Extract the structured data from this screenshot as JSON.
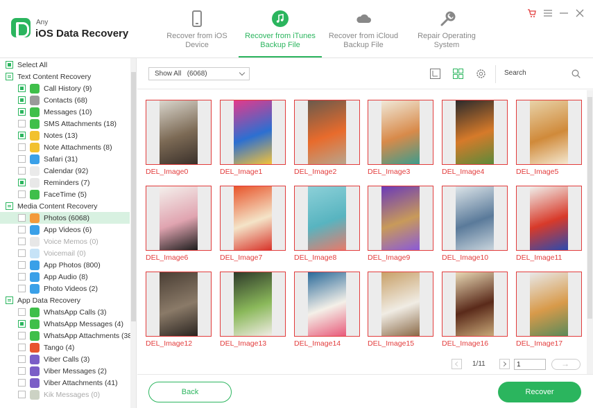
{
  "app": {
    "brand_prefix": "Any",
    "title": "iOS Data Recovery"
  },
  "nav_tabs": [
    {
      "label": "Recover from iOS\nDevice",
      "icon": "phone-icon",
      "active": false
    },
    {
      "label": "Recover from iTunes\nBackup File",
      "icon": "music-icon",
      "active": true
    },
    {
      "label": "Recover from iCloud\nBackup File",
      "icon": "cloud-icon",
      "active": false
    },
    {
      "label": "Repair Operating\nSystem",
      "icon": "wrench-icon",
      "active": false
    }
  ],
  "window_controls": [
    "cart-icon",
    "menu-icon",
    "minimize-icon",
    "close-icon"
  ],
  "sidebar": {
    "select_all": "Select All",
    "rows": [
      {
        "type": "category",
        "label": "Text Content Recovery"
      },
      {
        "type": "item",
        "label": "Call History (9)",
        "checked": true,
        "icon_color": "#3fbf4a",
        "icon": "phone-icon"
      },
      {
        "type": "item",
        "label": "Contacts (68)",
        "checked": true,
        "icon_color": "#9a9a9a",
        "icon": "contacts-icon"
      },
      {
        "type": "item",
        "label": "Messages (10)",
        "checked": true,
        "icon_color": "#3fbf4a",
        "icon": "message-icon"
      },
      {
        "type": "item",
        "label": "SMS Attachments (18)",
        "checked": false,
        "icon_color": "#3fbf4a",
        "icon": "attachment-icon"
      },
      {
        "type": "item",
        "label": "Notes (13)",
        "checked": true,
        "icon_color": "#f2c12e",
        "icon": "notes-icon"
      },
      {
        "type": "item",
        "label": "Note Attachments (8)",
        "checked": false,
        "icon_color": "#f2c12e",
        "icon": "note-attachment-icon"
      },
      {
        "type": "item",
        "label": "Safari (31)",
        "checked": false,
        "icon_color": "#3aa0e8",
        "icon": "safari-icon"
      },
      {
        "type": "item",
        "label": "Calendar (92)",
        "checked": false,
        "icon_color": "#eaeaea",
        "icon": "calendar-icon"
      },
      {
        "type": "item",
        "label": "Reminders (7)",
        "checked": true,
        "icon_color": "#e8e8e8",
        "icon": "reminders-icon"
      },
      {
        "type": "item",
        "label": "FaceTime (5)",
        "checked": false,
        "icon_color": "#3fbf4a",
        "icon": "facetime-icon"
      },
      {
        "type": "category",
        "label": "Media Content Recovery"
      },
      {
        "type": "item",
        "label": "Photos (6068)",
        "checked": false,
        "selected": true,
        "icon_color": "#f39a3c",
        "icon": "photos-icon"
      },
      {
        "type": "item",
        "label": "App Videos (6)",
        "checked": false,
        "icon_color": "#3aa0e8",
        "icon": "app-videos-icon"
      },
      {
        "type": "item",
        "label": "Voice Memos (0)",
        "checked": false,
        "disabled": true,
        "icon_color": "#cfcfcf",
        "icon": "voice-memos-icon"
      },
      {
        "type": "item",
        "label": "Voicemail (0)",
        "checked": false,
        "disabled": true,
        "icon_color": "#8ec7ef",
        "icon": "voicemail-icon"
      },
      {
        "type": "item",
        "label": "App Photos (800)",
        "checked": false,
        "icon_color": "#3aa0e8",
        "icon": "app-photos-icon"
      },
      {
        "type": "item",
        "label": "App Audio (8)",
        "checked": false,
        "icon_color": "#3aa0e8",
        "icon": "app-audio-icon"
      },
      {
        "type": "item",
        "label": "Photo Videos (2)",
        "checked": false,
        "icon_color": "#3aa0e8",
        "icon": "photo-videos-icon"
      },
      {
        "type": "category",
        "label": "App Data Recovery"
      },
      {
        "type": "item",
        "label": "WhatsApp Calls (3)",
        "checked": false,
        "icon_color": "#3fbf4a",
        "icon": "whatsapp-calls-icon"
      },
      {
        "type": "item",
        "label": "WhatsApp Messages (4)",
        "checked": true,
        "icon_color": "#3fbf4a",
        "icon": "whatsapp-icon"
      },
      {
        "type": "item",
        "label": "WhatsApp Attachments (38)",
        "checked": false,
        "icon_color": "#3fbf4a",
        "icon": "whatsapp-attachments-icon"
      },
      {
        "type": "item",
        "label": "Tango (4)",
        "checked": false,
        "icon_color": "#e8542e",
        "icon": "tango-icon"
      },
      {
        "type": "item",
        "label": "Viber Calls (3)",
        "checked": false,
        "icon_color": "#7b5ec7",
        "icon": "viber-icon"
      },
      {
        "type": "item",
        "label": "Viber Messages (2)",
        "checked": false,
        "icon_color": "#7b5ec7",
        "icon": "viber-messages-icon"
      },
      {
        "type": "item",
        "label": "Viber Attachments (41)",
        "checked": false,
        "icon_color": "#7b5ec7",
        "icon": "viber-attachments-icon"
      },
      {
        "type": "item",
        "label": "Kik Messages (0)",
        "checked": false,
        "disabled": true,
        "icon_color": "#9aa58a",
        "icon": "kik-icon"
      }
    ]
  },
  "toolbar": {
    "filter_value": "Show All   (6068)",
    "search_label": "Search",
    "tools": [
      "calendar-filter-icon",
      "grid-view-icon",
      "settings-icon"
    ]
  },
  "thumbnails": [
    {
      "label": "DEL_Image0",
      "colors": [
        "#d9d5cc",
        "#7c6a55",
        "#3a302a"
      ]
    },
    {
      "label": "DEL_Image1",
      "colors": [
        "#e33a8c",
        "#2c6fd1",
        "#f3c23a"
      ]
    },
    {
      "label": "DEL_Image2",
      "colors": [
        "#6a5a4c",
        "#e86b2c",
        "#b9a48c"
      ]
    },
    {
      "label": "DEL_Image3",
      "colors": [
        "#f0e8d8",
        "#d88a4a",
        "#3e9c8c"
      ]
    },
    {
      "label": "DEL_Image4",
      "colors": [
        "#2b2a2c",
        "#d67a2a",
        "#5c8a3a"
      ]
    },
    {
      "label": "DEL_Image5",
      "colors": [
        "#e8d2a8",
        "#d08a3a",
        "#f4e8d0"
      ]
    },
    {
      "label": "DEL_Image6",
      "colors": [
        "#f4f0ec",
        "#e0a4b0",
        "#1e1e1e"
      ]
    },
    {
      "label": "DEL_Image7",
      "colors": [
        "#e8542a",
        "#f4e4c8",
        "#d8342a"
      ]
    },
    {
      "label": "DEL_Image8",
      "colors": [
        "#8cd0d8",
        "#58b4c0",
        "#e87a6a"
      ]
    },
    {
      "label": "DEL_Image9",
      "colors": [
        "#6a3ab8",
        "#c89a5a",
        "#8a5ad8"
      ]
    },
    {
      "label": "DEL_Image10",
      "colors": [
        "#dce4e8",
        "#5a7a9a",
        "#c8d4dc"
      ]
    },
    {
      "label": "DEL_Image11",
      "colors": [
        "#f0f0ec",
        "#d83a2a",
        "#2a4ab0"
      ]
    },
    {
      "label": "DEL_Image12",
      "colors": [
        "#4a3e34",
        "#8a7a68",
        "#2a2420"
      ]
    },
    {
      "label": "DEL_Image13",
      "colors": [
        "#2e3a2a",
        "#8ab85a",
        "#f0ece4"
      ]
    },
    {
      "label": "DEL_Image14",
      "colors": [
        "#2a6a9a",
        "#f4f0e8",
        "#e85a7a"
      ]
    },
    {
      "label": "DEL_Image15",
      "colors": [
        "#c8a068",
        "#f0ece4",
        "#8a6a48"
      ]
    },
    {
      "label": "DEL_Image16",
      "colors": [
        "#e8d8b4",
        "#5a2a1a",
        "#c8a878"
      ]
    },
    {
      "label": "DEL_Image17",
      "colors": [
        "#e8e8e8",
        "#d89a4a",
        "#5a8a5a"
      ]
    }
  ],
  "pagination": {
    "page_text": "1/11",
    "page_input": "1"
  },
  "footer": {
    "back_label": "Back",
    "recover_label": "Recover"
  },
  "colors": {
    "accent": "#2bb55e",
    "deleted_red": "#e23b3b"
  }
}
